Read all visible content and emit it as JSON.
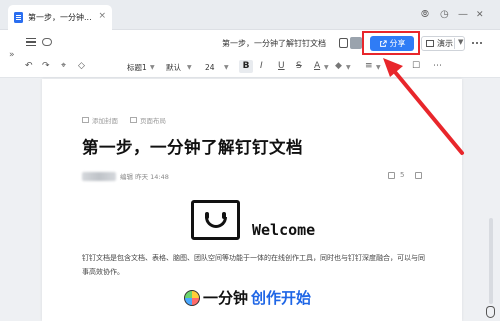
{
  "tab": {
    "title": "第一步，一分钟...",
    "close": "×"
  },
  "window_controls": {
    "pin": "⦾",
    "help": "◷",
    "minimize": "—",
    "maximize": "▢",
    "close": "✕"
  },
  "docbar": {
    "title": "第一步，一分钟了解钉钉文档",
    "share_label": "分享",
    "present_label": "演示"
  },
  "toolbar": {
    "heading_style": "标题1",
    "font_family": "默认",
    "font_size": "24",
    "bold": "B",
    "italic": "I",
    "underline": "U",
    "strike": "S",
    "font_color": "A",
    "highlight": "◆",
    "undo": "↶",
    "redo": "↷",
    "format_painter": "⌖",
    "clear_format": "◇",
    "list": "≡",
    "more": "⋯"
  },
  "page": {
    "add_cover": "添加封面",
    "page_layout": "页面布局",
    "title": "第一步，一分钟了解钉钉文档",
    "author_meta": "编辑  昨天 14:48",
    "stat_tasks": "5",
    "welcome": "Welcome",
    "intro": "钉钉文档是包含文档、表格、脑图、团队空间等功能于一体的在线创作工具，同时也与钉钉深度融合，可以与同事高效协作。",
    "heading2_part1": "一分钟",
    "heading2_part2": "创作开始"
  },
  "colors": {
    "accent": "#2f7cf6",
    "annotation": "#e8262b"
  }
}
